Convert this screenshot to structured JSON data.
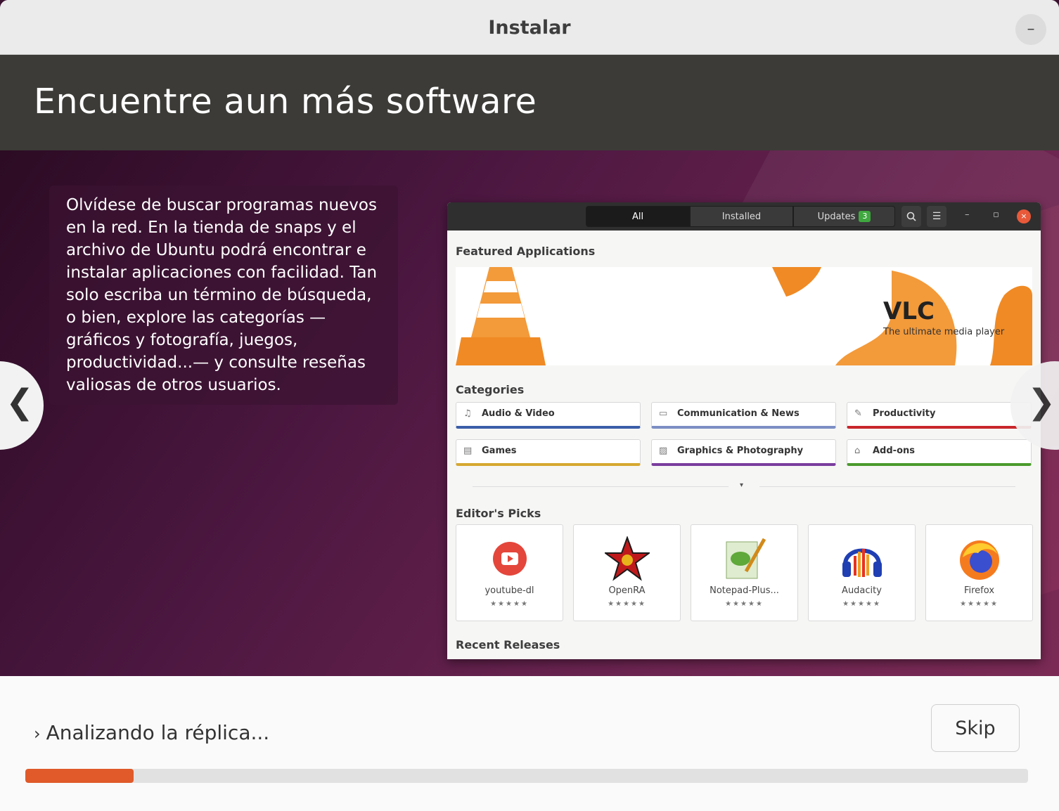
{
  "window": {
    "title": "Instalar",
    "minimize_icon": "minimize-icon"
  },
  "header": {
    "title": "Encuentre aun más software"
  },
  "slide": {
    "description": "Olvídese de buscar programas nuevos en la red. En la tienda de snaps y el archivo de Ubuntu podrá encontrar e instalar aplicaciones con facilidad. Tan solo escriba un término de búsqueda, o bien, explore las categorías —gráficos y fotografía, juegos, productividad...— y consulte reseñas valiosas de otros usuarios.",
    "prev_icon": "chevron-left-icon",
    "next_icon": "chevron-right-icon",
    "prev_glyph": "❮",
    "next_glyph": "❯"
  },
  "software": {
    "tabs": {
      "all": "All",
      "installed": "Installed",
      "updates": "Updates",
      "updates_count": "3"
    },
    "featured_title": "Featured Applications",
    "banner": {
      "name": "VLC",
      "tagline": "The ultimate media player"
    },
    "categories_title": "Categories",
    "categories": [
      {
        "label": "Audio & Video",
        "icon": "♫",
        "color": "#3b5ea8"
      },
      {
        "label": "Communication & News",
        "icon": "▭",
        "color": "#7c8ec4"
      },
      {
        "label": "Productivity",
        "icon": "✎",
        "color": "#c8262b"
      },
      {
        "label": "Games",
        "icon": "▤",
        "color": "#d6a830"
      },
      {
        "label": "Graphics & Photography",
        "icon": "▨",
        "color": "#7a3d9e"
      },
      {
        "label": "Add-ons",
        "icon": "⌂",
        "color": "#4a9a2c"
      }
    ],
    "editors_title": "Editor's Picks",
    "picks": [
      {
        "name": "youtube-dl",
        "stars": "★★★★★"
      },
      {
        "name": "OpenRA",
        "stars": "★★★★★"
      },
      {
        "name": "Notepad-Plus...",
        "stars": "★★★★★"
      },
      {
        "name": "Audacity",
        "stars": "★★★★★"
      },
      {
        "name": "Firefox",
        "stars": "★★★★★"
      }
    ],
    "recent_title": "Recent Releases"
  },
  "footer": {
    "status": "Analizando la réplica...",
    "skip_label": "Skip",
    "progress": 0.108,
    "accent": "#e05a2a"
  }
}
